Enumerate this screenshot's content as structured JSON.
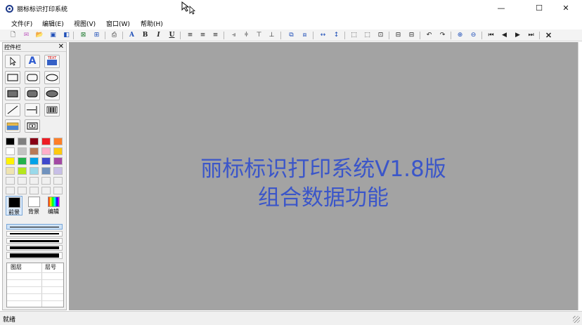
{
  "window": {
    "title": "丽标标识打印系统",
    "minimize_icon": "minimize-icon",
    "maximize_icon": "maximize-icon",
    "close_icon": "close-icon"
  },
  "menubar": {
    "items": [
      "文件(F)",
      "编辑(E)",
      "视图(V)",
      "窗口(W)",
      "帮助(H)"
    ]
  },
  "toolbar": {
    "icons": [
      "new-doc-icon",
      "template-icon",
      "open-icon",
      "save-icon",
      "save-all-icon",
      "export-icon",
      "grid-icon",
      "print-icon",
      "font-icon",
      "bold-icon",
      "italic-icon",
      "underline-icon",
      "align-left-icon",
      "align-center-icon",
      "align-right-icon",
      "align-objects-left-icon",
      "align-objects-center-icon",
      "align-objects-top-icon",
      "align-objects-bottom-icon",
      "group-icon",
      "ungroup-icon",
      "same-width-icon",
      "same-height-icon",
      "distribute-h-icon",
      "distribute-v-icon",
      "center-icon",
      "bring-front-icon",
      "send-back-icon",
      "undo-icon",
      "redo-icon",
      "zoom-in-icon",
      "zoom-out-icon",
      "first-page-icon",
      "prev-page-icon",
      "next-page-icon",
      "last-page-icon",
      "delete-icon"
    ]
  },
  "panel": {
    "title": "控件栏",
    "close_label": "✕",
    "tools": [
      "pointer-tool-icon",
      "text-tool-icon",
      "text-box-tool-icon",
      "rectangle-tool-icon",
      "rounded-rectangle-tool-icon",
      "ellipse-tool-icon",
      "filled-rectangle-tool-icon",
      "filled-rounded-rectangle-tool-icon",
      "filled-ellipse-tool-icon",
      "line-tool-icon",
      "orthogonal-line-tool-icon",
      "barcode-tool-icon",
      "image-tool-icon",
      "serial-number-tool-icon"
    ],
    "palette": [
      "#000000",
      "#7f7f7f",
      "#880015",
      "#ed1c24",
      "#ff7f27",
      "#ffffff",
      "#c3c3c3",
      "#b97a57",
      "#ffaec9",
      "#ffc90e",
      "#fff200",
      "#22b14c",
      "#00a2e8",
      "#3f48cc",
      "#a349a4",
      "#efe4b0",
      "#b5e61d",
      "#99d9ea",
      "#7092be",
      "#c8bfe7",
      "#f0f0f0",
      "#f0f0f0",
      "#f0f0f0",
      "#f0f0f0",
      "#f0f0f0",
      "#f0f0f0",
      "#f0f0f0",
      "#f0f0f0",
      "#f0f0f0",
      "#f0f0f0"
    ],
    "foreground_label": "前景",
    "background_label": "背景",
    "edit_label": "编辑",
    "foreground_color": "#000000",
    "background_color": "#ffffff",
    "line_widths": [
      1,
      2,
      3,
      5,
      7
    ],
    "layers": {
      "col1": "图层",
      "col2": "层号"
    }
  },
  "canvas": {
    "background": "#a3a3a3",
    "line1": "丽标标识打印系统V1.8版",
    "line2": "组合数据功能",
    "text_color": "#3b56c9"
  },
  "status": {
    "text": "就绪"
  }
}
